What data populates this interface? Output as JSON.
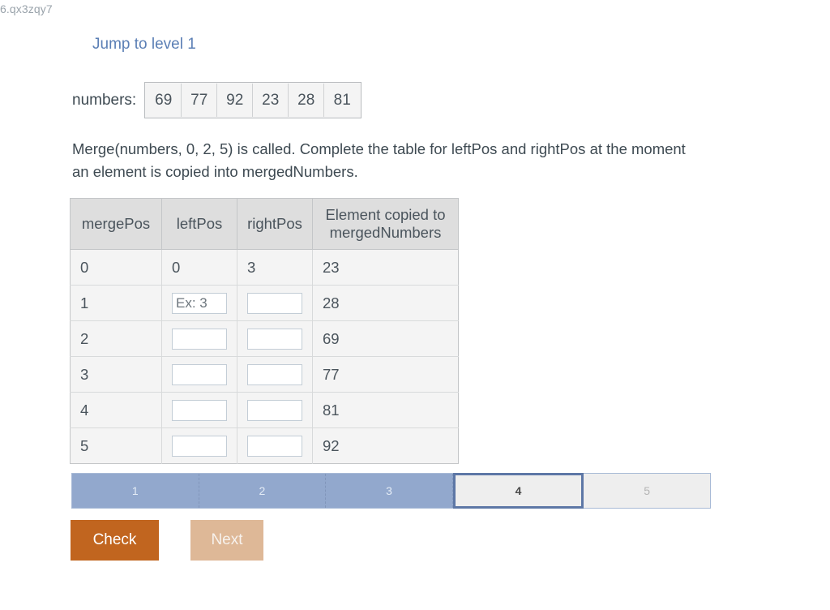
{
  "page_fragment": "6.qx3zqy7",
  "jump_link": {
    "label": "Jump to level 1"
  },
  "array": {
    "label": "numbers:",
    "values": [
      "69",
      "77",
      "92",
      "23",
      "28",
      "81"
    ]
  },
  "prompt": "Merge(numbers, 0, 2, 5) is called. Complete the table for leftPos and rightPos at the moment an element is copied into mergedNumbers.",
  "table": {
    "headers": [
      "mergePos",
      "leftPos",
      "rightPos",
      "Element copied to mergedNumbers"
    ],
    "rows": [
      {
        "mergePos": "0",
        "leftPos": {
          "type": "text",
          "value": "0"
        },
        "rightPos": {
          "type": "text",
          "value": "3"
        },
        "element": "23"
      },
      {
        "mergePos": "1",
        "leftPos": {
          "type": "input",
          "value": "",
          "placeholder": "Ex: 3"
        },
        "rightPos": {
          "type": "input",
          "value": "",
          "placeholder": ""
        },
        "element": "28"
      },
      {
        "mergePos": "2",
        "leftPos": {
          "type": "input",
          "value": "",
          "placeholder": ""
        },
        "rightPos": {
          "type": "input",
          "value": "",
          "placeholder": ""
        },
        "element": "69"
      },
      {
        "mergePos": "3",
        "leftPos": {
          "type": "input",
          "value": "",
          "placeholder": ""
        },
        "rightPos": {
          "type": "input",
          "value": "",
          "placeholder": ""
        },
        "element": "77"
      },
      {
        "mergePos": "4",
        "leftPos": {
          "type": "input",
          "value": "",
          "placeholder": ""
        },
        "rightPos": {
          "type": "input",
          "value": "",
          "placeholder": ""
        },
        "element": "81"
      },
      {
        "mergePos": "5",
        "leftPos": {
          "type": "input",
          "value": "",
          "placeholder": ""
        },
        "rightPos": {
          "type": "input",
          "value": "",
          "placeholder": ""
        },
        "element": "92"
      }
    ]
  },
  "progress": {
    "levels": [
      {
        "label": "1",
        "state": "done"
      },
      {
        "label": "2",
        "state": "done"
      },
      {
        "label": "3",
        "state": "done"
      },
      {
        "label": "4",
        "state": "current"
      },
      {
        "label": "5",
        "state": "todo"
      }
    ]
  },
  "buttons": {
    "check": "Check",
    "next": "Next"
  },
  "colors": {
    "accent_orange": "#c1651f",
    "accent_orange_disabled": "#deb897",
    "progress_blue": "#92a8cd",
    "progress_border": "#5d77a6",
    "link_blue": "#5b7fb5"
  }
}
